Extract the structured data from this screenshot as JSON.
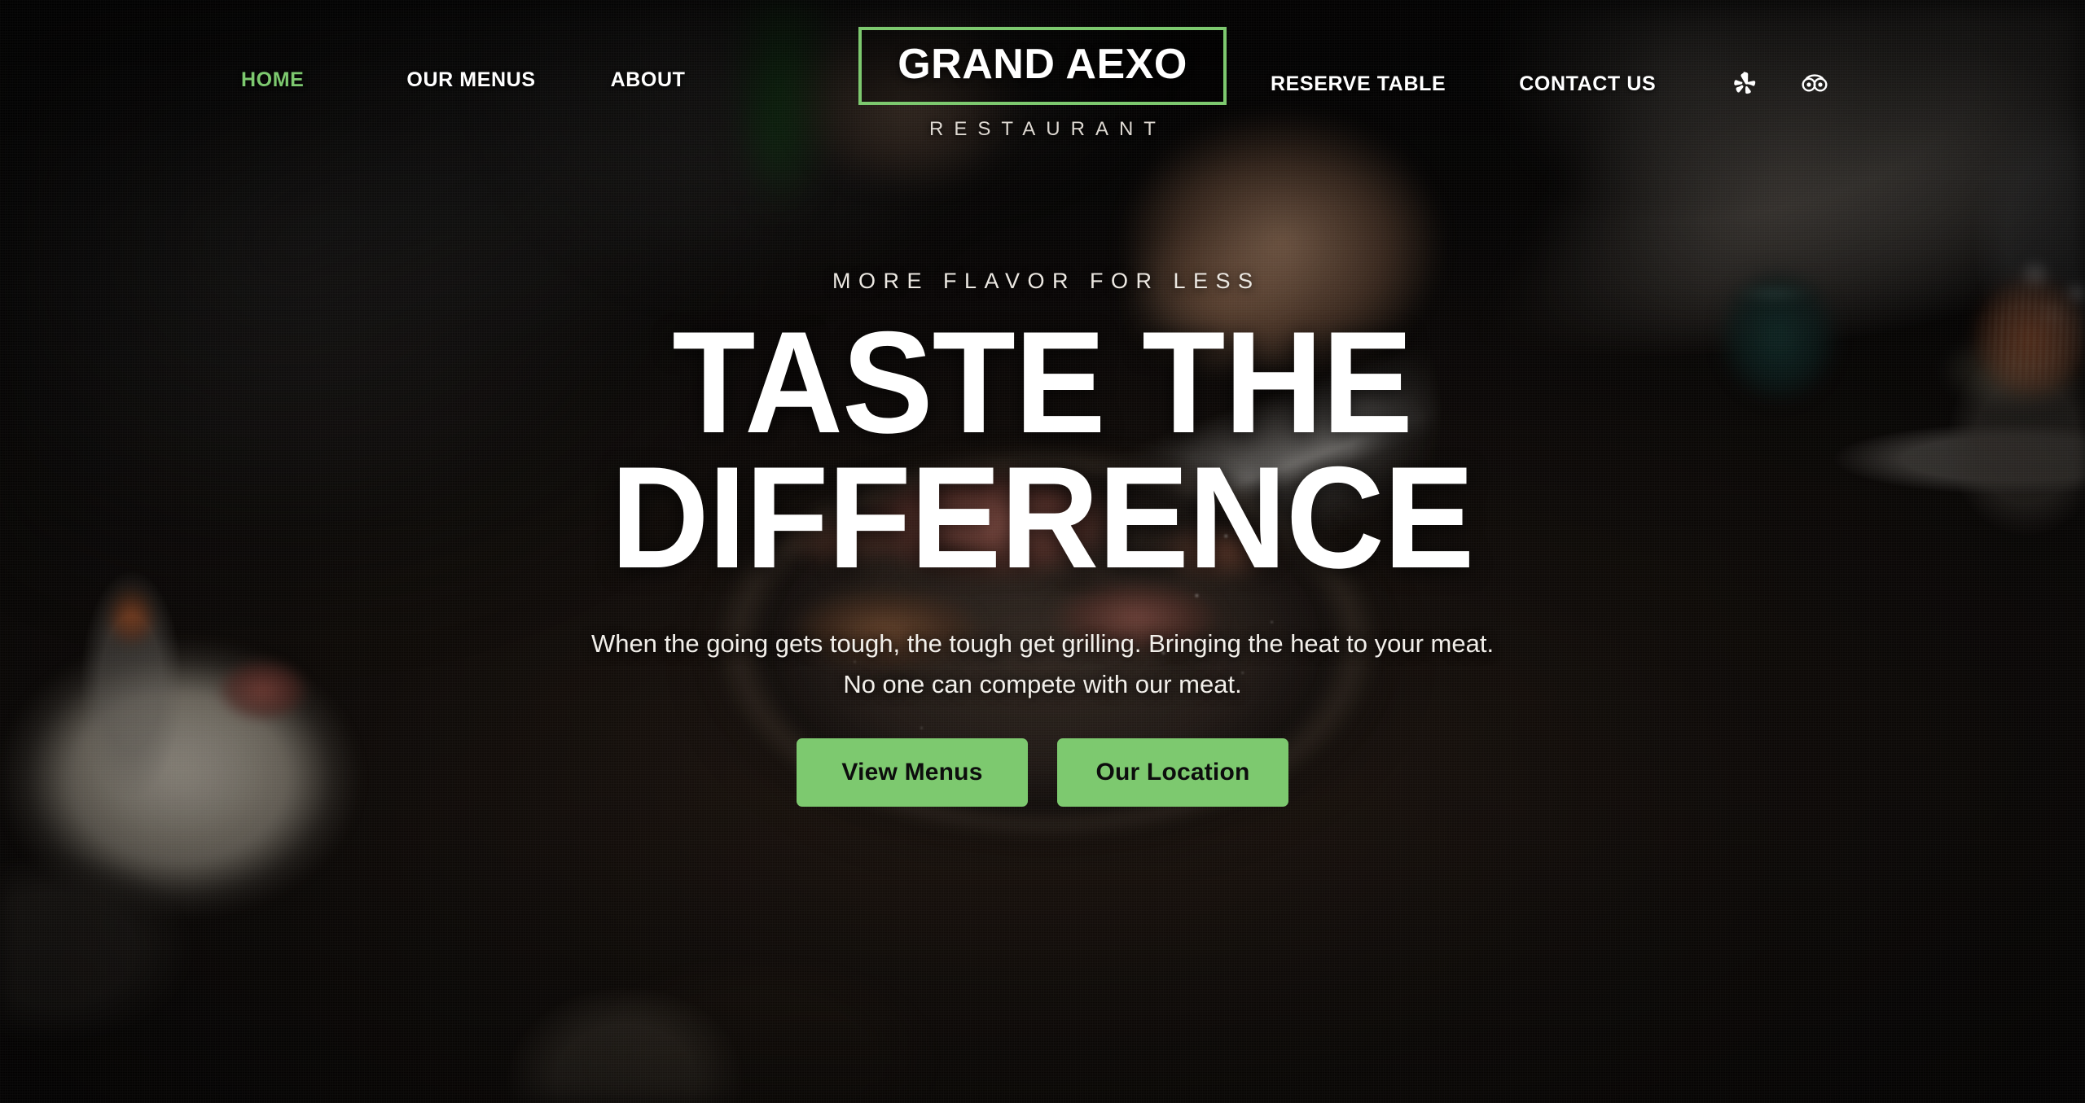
{
  "brand": {
    "logo_name": "GRAND AEXO",
    "logo_subtitle": "RESTAURANT",
    "accent_green": "#7dc96f",
    "button_text_color": "#0d0d0d"
  },
  "nav": {
    "left_items": [
      {
        "label": "HOME",
        "active": true
      },
      {
        "label": "OUR MENUS",
        "active": false
      },
      {
        "label": "ABOUT",
        "active": false
      }
    ],
    "right_items": [
      {
        "label": "RESERVE TABLE",
        "active": false
      },
      {
        "label": "CONTACT US",
        "active": false
      }
    ],
    "social": [
      {
        "name": "yelp-icon",
        "label": "Yelp"
      },
      {
        "name": "tripadvisor-icon",
        "label": "Tripadvisor"
      }
    ]
  },
  "hero": {
    "eyebrow": "MORE FLAVOR FOR LESS",
    "headline_line_1": "TASTE THE",
    "headline_line_2": "DIFFERENCE",
    "subtext_line_1": "When the going gets tough, the tough get grilling. Bringing the heat to your meat.",
    "subtext_line_2": "No one can compete with our meat.",
    "cta_primary": "View Menus",
    "cta_secondary": "Our Location"
  }
}
